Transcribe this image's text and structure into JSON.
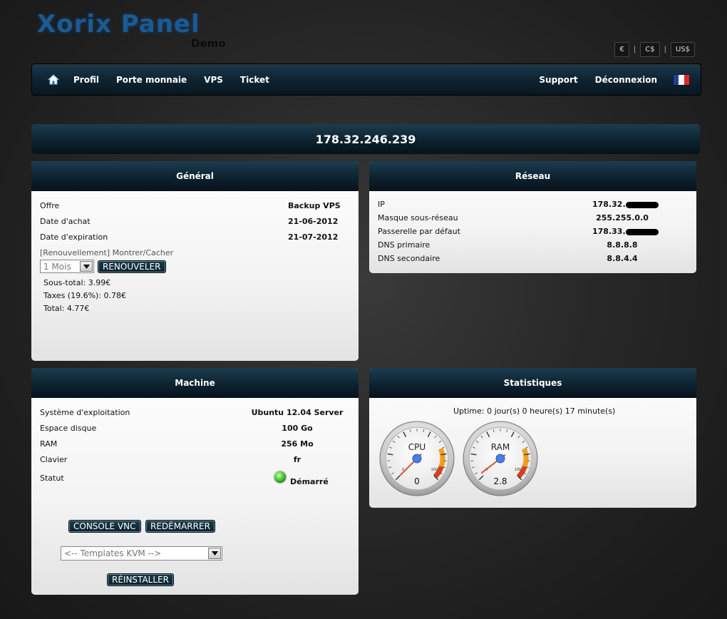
{
  "brand": {
    "title": "Xorix Panel",
    "subtitle": "Demo"
  },
  "currency": {
    "eur": "€",
    "cad": "C$",
    "usd": "US$",
    "sep": "|"
  },
  "nav": {
    "left": [
      "Profil",
      "Porte monnaie",
      "VPS",
      "Ticket"
    ],
    "right": [
      "Support",
      "Déconnexion"
    ],
    "flag_colors": [
      "#1f3f9a",
      "#ffffff",
      "#e2242b"
    ]
  },
  "ip_title": "178.32.246.239",
  "general": {
    "title": "Général",
    "rows": [
      {
        "label": "Offre",
        "value": "Backup VPS"
      },
      {
        "label": "Date d'achat",
        "value": "21-06-2012"
      },
      {
        "label": "Date d'expiration",
        "value": "21-07-2012"
      }
    ],
    "renew_link": "[Renouvellement] Montrer/Cacher",
    "duration_selected": "1 Mois",
    "renew_button": "RENOUVELER",
    "subtotal": "Sous-total: 3.99€",
    "taxes": "Taxes (19.6%): 0.78€",
    "total": "Total: 4.77€"
  },
  "reseau": {
    "title": "Réseau",
    "rows": [
      {
        "label": "IP",
        "value": "178.32."
      },
      {
        "label": "Masque sous-réseau",
        "value": "255.255.0.0"
      },
      {
        "label": "Passerelle par défaut",
        "value": "178.33."
      },
      {
        "label": "DNS primaire",
        "value": "8.8.8.8"
      },
      {
        "label": "DNS secondaire",
        "value": "8.8.4.4"
      }
    ]
  },
  "machine": {
    "title": "Machine",
    "rows": [
      {
        "label": "Système d'exploitation",
        "value": "Ubuntu 12.04 Server"
      },
      {
        "label": "Espace disque",
        "value": "100 Go"
      },
      {
        "label": "RAM",
        "value": "256 Mo"
      },
      {
        "label": "Clavier",
        "value": "fr"
      }
    ],
    "status_label": "Statut",
    "status_value": "Démarré",
    "status_color": "#3cc03c",
    "console_button": "CONSOLE VNC",
    "restart_button": "REDÉMARRER",
    "template_placeholder": "<-- Templates KVM -->",
    "reinstall_button": "RÉINSTALLER"
  },
  "stats": {
    "title": "Statistiques",
    "uptime": "Uptime: 0 jour(s) 0 heure(s) 17 minute(s)",
    "gauges": [
      {
        "name": "CPU",
        "value": 0,
        "display": "0",
        "max": 100,
        "max_label": "100",
        "zero_label": "0"
      },
      {
        "name": "RAM",
        "value": 2.8,
        "display": "2.8",
        "max": 100,
        "max_label": "100",
        "zero_label": "0"
      }
    ]
  }
}
